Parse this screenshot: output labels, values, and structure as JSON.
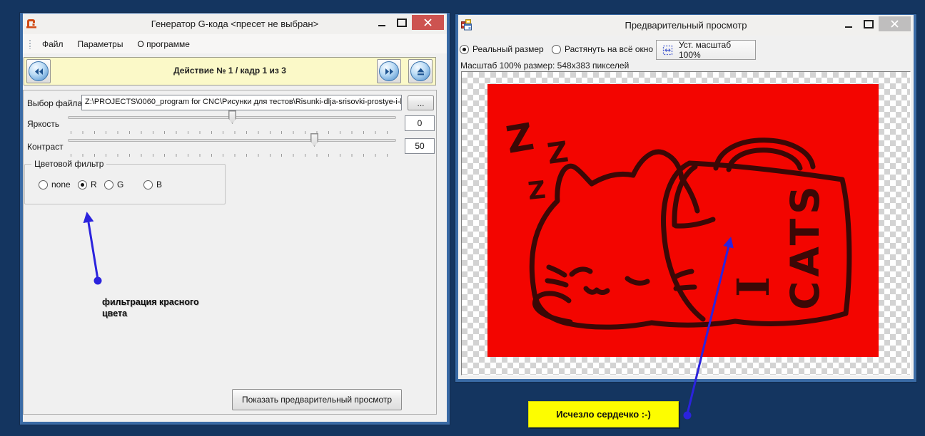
{
  "left": {
    "title": "Генератор G-кода <пресет не выбран>",
    "menu": [
      "Файл",
      "Параметры",
      "О программе"
    ],
    "action_text": "Действие № 1 / кадр 1 из 3",
    "file_label": "Выбор файла:",
    "file_path": "Z:\\PROJECTS\\0060_program for CNC\\Рисунки для тестов\\Risunki-dlja-srisovki-prostye-i-kra",
    "browse": "...",
    "brightness_label": "Яркость",
    "brightness_value": "0",
    "brightness_percent": 50,
    "contrast_label": "Контраст",
    "contrast_value": "50",
    "contrast_percent": 75,
    "filter_title": "Цветовой фильтр",
    "filter_options": [
      {
        "label": "none",
        "selected": false
      },
      {
        "label": "R",
        "selected": true
      },
      {
        "label": "G",
        "selected": false
      },
      {
        "label": "B",
        "selected": false
      }
    ],
    "preview_btn": "Показать предварительный просмотр",
    "annotation_line1": "фильтрация красного",
    "annotation_line2": "цвета"
  },
  "right": {
    "title": "Предварительный просмотр",
    "radio_real": "Реальный размер",
    "radio_stretch": "Растянуть на всё окно",
    "scale_btn": "Уст. масштаб 100%",
    "scale_info": "Масштаб 100% размер: 548x383 пикселей",
    "note": "Исчезло сердечко :-)"
  },
  "image": {
    "z1": "Z",
    "z2": "Z",
    "z3": "Z",
    "letter_i": "I",
    "word_cats": "CATS"
  },
  "colors": {
    "desktop": "#143560",
    "window_border": "#3a6ba6",
    "close_active": "#cd5350",
    "close_inactive": "#bfbebe",
    "banner": "#fbf9c8",
    "red_image": "#f30500",
    "ink": "#3b0806",
    "arrow": "#2b23dd",
    "note": "#fdfd00"
  }
}
